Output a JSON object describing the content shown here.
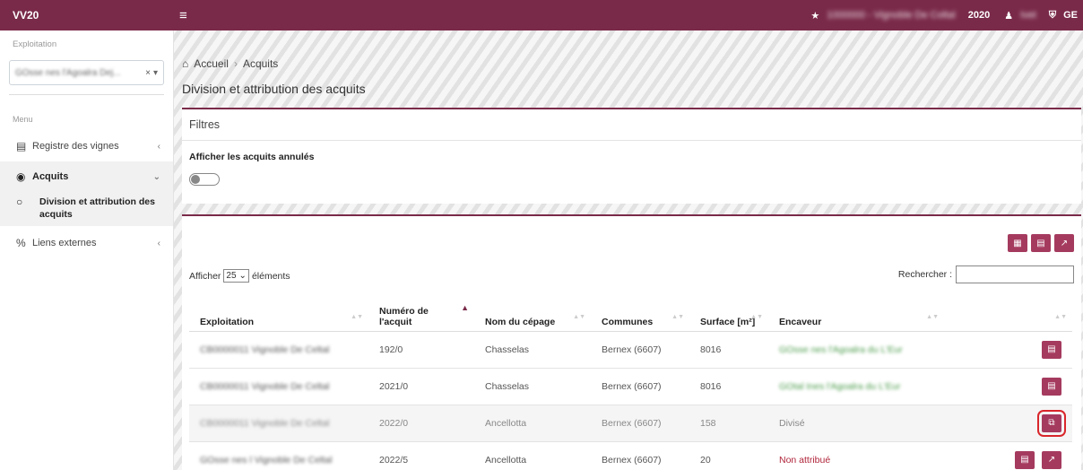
{
  "app": {
    "brand": "VV20",
    "year": "2020",
    "user_blur": "Ivet",
    "user_initials": "GE",
    "exploitation_blur": "1000000 - Vignoble De Coltal"
  },
  "sidebar": {
    "exploitation_label": "Exploitation",
    "exploitation_value": "GOsse nes l'Agoalra Dej...",
    "clear": "×",
    "caret": "▾",
    "menu_label": "Menu",
    "items": [
      {
        "label": "Registre des vignes",
        "arrow": "‹"
      },
      {
        "label": "Acquits",
        "arrow": "⌄"
      },
      {
        "label": "Division et attribution des acquits"
      },
      {
        "label": "Liens externes",
        "arrow": "‹"
      }
    ]
  },
  "breadcrumb": {
    "home": "Accueil",
    "sep": "›",
    "current": "Acquits"
  },
  "page_title": "Division et attribution des acquits",
  "filters": {
    "title": "Filtres",
    "show_cancelled_label": "Afficher les acquits annulés"
  },
  "table": {
    "length_prefix": "Afficher",
    "length_value": "25",
    "length_suffix": "éléments",
    "search_label": "Rechercher :",
    "headers": [
      "Exploitation",
      "Numéro de l'acquit",
      "Nom du cépage",
      "Communes",
      "Surface [m²]",
      "Encaveur",
      ""
    ],
    "rows": [
      {
        "exploitation": "CB0000011 Vignoble De Celtal",
        "numero": "192/0",
        "cepage": "Chasselas",
        "commune": "Bernex (6607)",
        "surface": "8016",
        "encaveur": "GOsse nes l'Agoalra du L'Eur"
      },
      {
        "exploitation": "CB0000011 Vignoble De Celtal",
        "numero": "2021/0",
        "cepage": "Chasselas",
        "commune": "Bernex (6607)",
        "surface": "8016",
        "encaveur": "GOtal Ines l'Agoalra du L'Eur"
      },
      {
        "exploitation": "CB0000011 Vignoble De Celtal",
        "numero": "2022/0",
        "cepage": "Ancellotta",
        "commune": "Bernex (6607)",
        "surface": "158",
        "encaveur": "Divisé"
      },
      {
        "exploitation": "GOsse nes l Vignoble De Celtal",
        "numero": "2022/5",
        "cepage": "Ancellotta",
        "commune": "Bernex (6607)",
        "surface": "20",
        "encaveur": "Non attribué"
      }
    ]
  },
  "colors": {
    "brand": "#7a2a49",
    "button": "#a53a5f",
    "highlight": "#d9262b"
  }
}
